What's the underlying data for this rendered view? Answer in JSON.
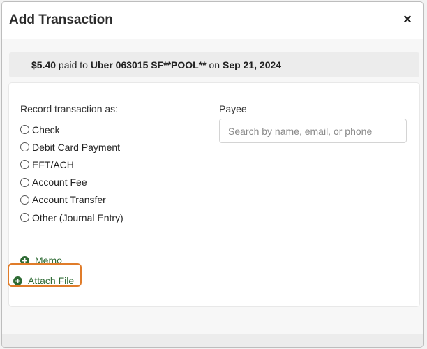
{
  "modal": {
    "title": "Add Transaction",
    "close_symbol": "×"
  },
  "summary": {
    "amount": "$5.40",
    "paid_to_text": " paid to ",
    "payee": "Uber 063015 SF**POOL**",
    "on_text": " on ",
    "date": "Sep 21, 2024"
  },
  "record_as": {
    "label": "Record transaction as:",
    "options": [
      "Check",
      "Debit Card Payment",
      "EFT/ACH",
      "Account Fee",
      "Account Transfer",
      "Other (Journal Entry)"
    ]
  },
  "payee": {
    "label": "Payee",
    "placeholder": "Search by name, email, or phone"
  },
  "actions": {
    "memo": "Memo",
    "attach_file": "Attach File"
  },
  "colors": {
    "accent_green": "#2e6b34",
    "highlight_orange": "#e07c2a"
  }
}
